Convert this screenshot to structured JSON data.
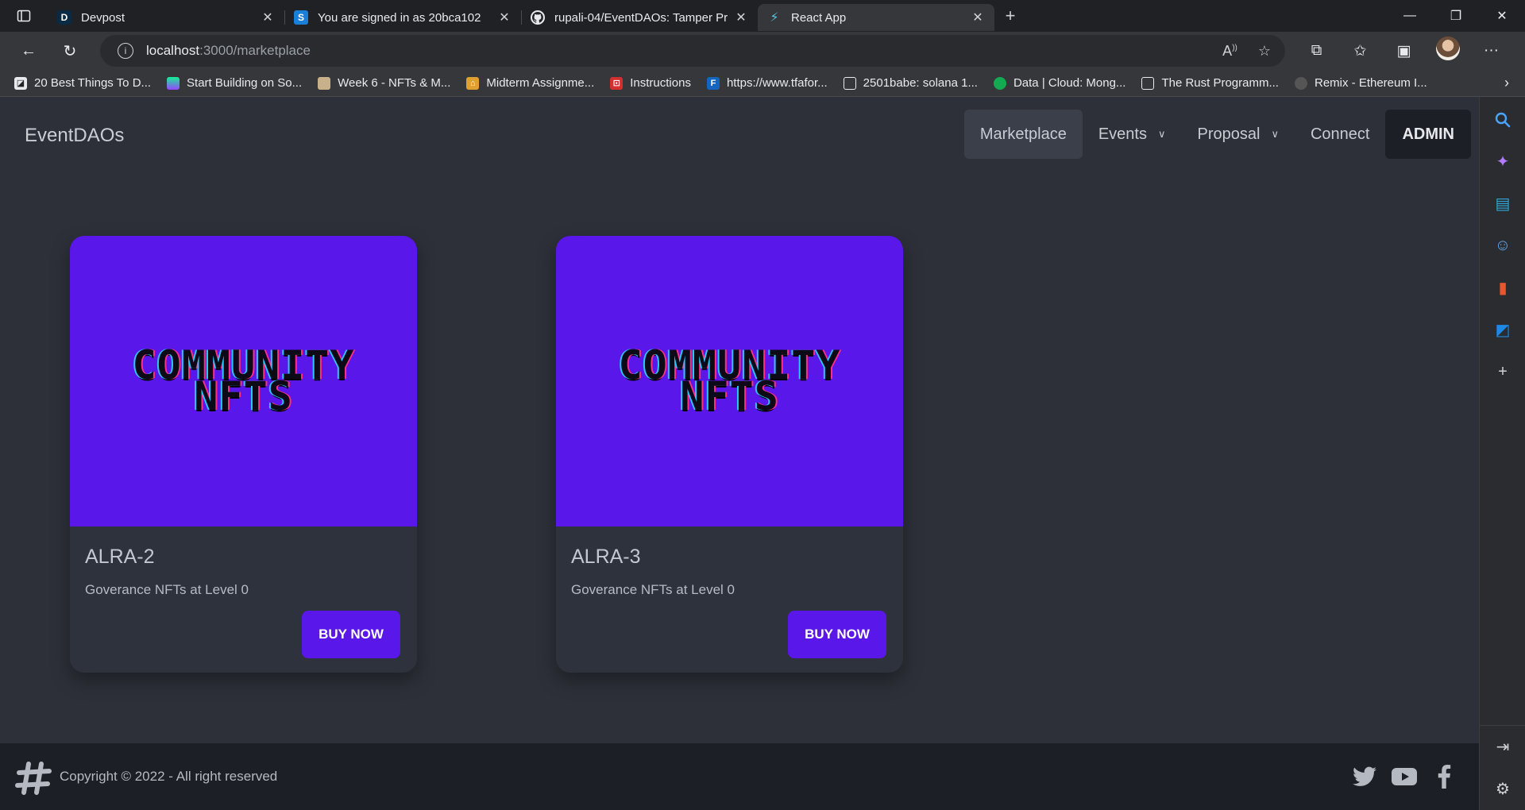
{
  "browser": {
    "tabs": [
      {
        "title": "Devpost",
        "favicon": "devpost-icon"
      },
      {
        "title": "You are signed in as 20bca102",
        "favicon": "s-icon"
      },
      {
        "title": "rupali-04/EventDAOs: Tamper Pr",
        "favicon": "github-icon"
      },
      {
        "title": "React App",
        "favicon": "react-icon"
      }
    ],
    "address": {
      "host": "localhost",
      "path": ":3000/marketplace"
    },
    "bookmarks": [
      "20 Best Things To D...",
      "Start Building on So...",
      "Week 6 - NFTs & M...",
      "Midterm Assignme...",
      "Instructions",
      "https://www.tfafor...",
      "2501babe: solana 1...",
      "Data | Cloud: Mong...",
      "The Rust Programm...",
      "Remix - Ethereum I..."
    ]
  },
  "app": {
    "brand": "EventDAOs",
    "menu": {
      "marketplace": "Marketplace",
      "events": "Events",
      "proposal": "Proposal",
      "connect": "Connect",
      "admin": "ADMIN"
    },
    "cards": [
      {
        "image_line1": "COMMUNITY",
        "image_line2": "NFTS",
        "title": "ALRA-2",
        "description": "Goverance NFTs at Level 0",
        "button": "BUY NOW"
      },
      {
        "image_line1": "COMMUNITY",
        "image_line2": "NFTS",
        "title": "ALRA-3",
        "description": "Goverance NFTs at Level 0",
        "button": "BUY NOW"
      }
    ],
    "footer": {
      "copyright": "Copyright © 2022 - All right reserved"
    }
  },
  "colors": {
    "accent": "#5a17ea",
    "background": "#2d3039",
    "footer": "#1c1f26"
  }
}
